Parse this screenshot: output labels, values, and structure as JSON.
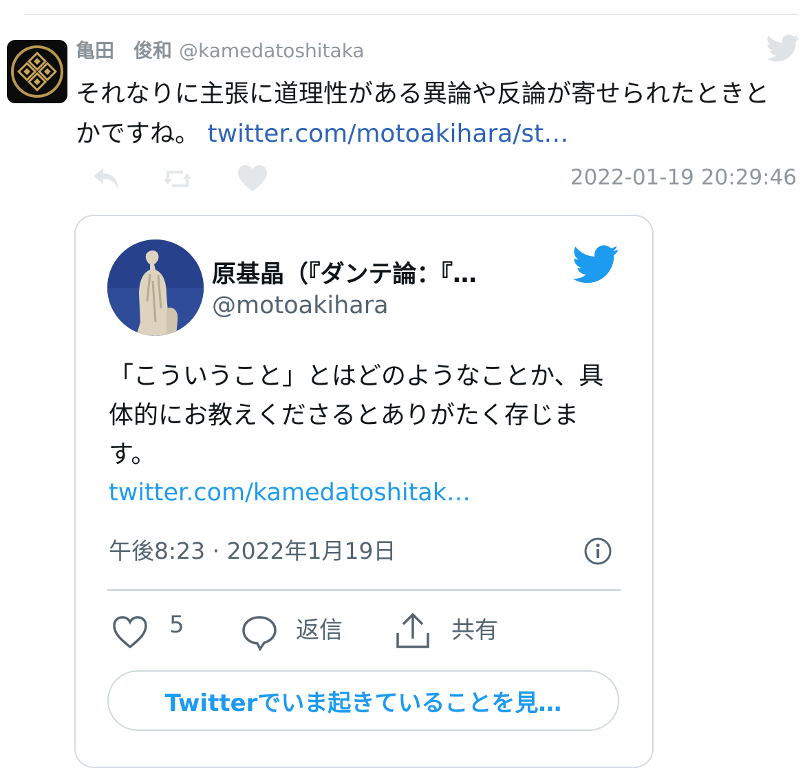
{
  "tweet": {
    "display_name": "亀田　俊和",
    "handle": "@kamedatoshitaka",
    "text": "それなりに主張に道理性がある異論や反論が寄せられたときとかですね。",
    "link": "twitter.com/motoakihara/st…",
    "timestamp": "2022-01-19 20:29:46",
    "icons": [
      "reply-icon",
      "retweet-icon",
      "like-icon",
      "twitter-bird-icon"
    ]
  },
  "quoted": {
    "display_name": "原基晶（『ダンテ論：『…",
    "handle": "@motoakihara",
    "text": "「こういうこと」とはどのようなことか、具体的にお教えくださるとありがたく存じます。",
    "link": "twitter.com/kamedatoshitak…",
    "time": "午後8:23 · 2022年1月19日",
    "like_count": "5",
    "reply_label": "返信",
    "share_label": "共有",
    "cta": "Twitterでいま起きていることを見…"
  },
  "colors": {
    "link_blue": "#1d9bf0",
    "body_link": "#2d63b8",
    "muted": "#8f979e",
    "border": "#d5dbe1"
  }
}
